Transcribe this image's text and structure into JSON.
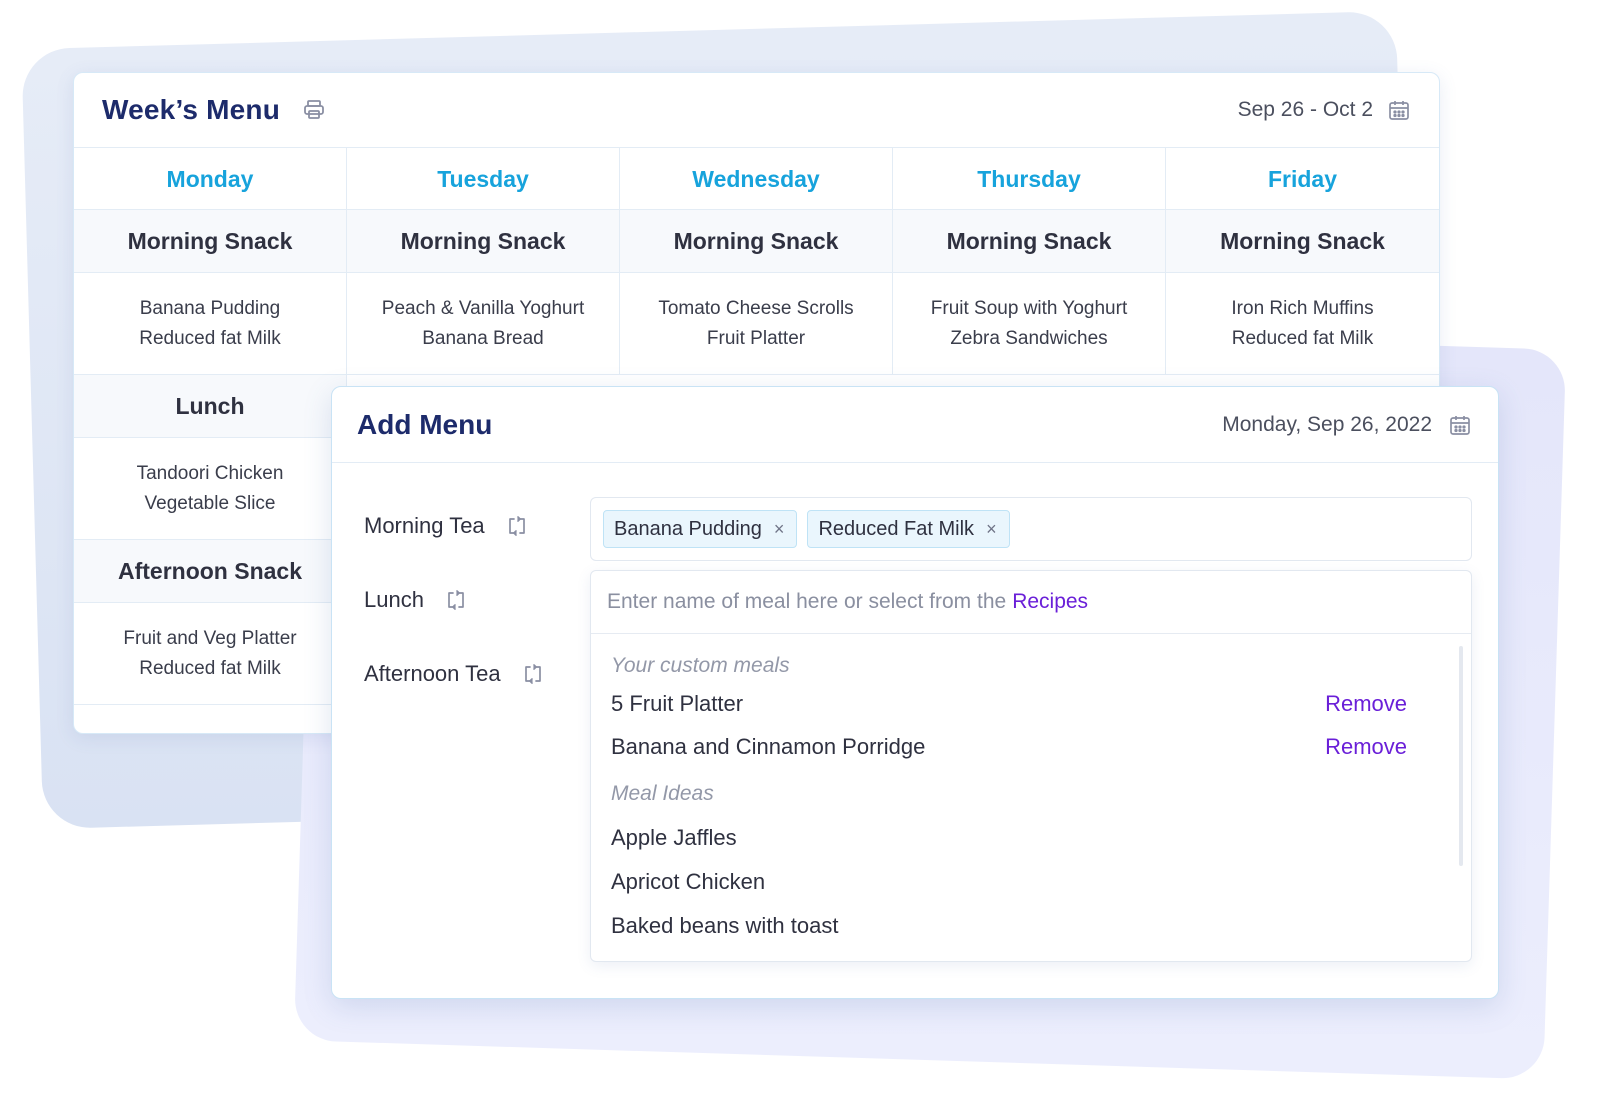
{
  "week_menu": {
    "title": "Week’s Menu",
    "date_range": "Sep 26 - Oct 2",
    "days": [
      "Monday",
      "Tuesday",
      "Wednesday",
      "Thursday",
      "Friday"
    ],
    "morning_snack": {
      "label": "Morning Snack",
      "items": [
        [
          "Banana Pudding",
          "Reduced fat Milk"
        ],
        [
          "Peach & Vanilla Yoghurt",
          "Banana Bread"
        ],
        [
          "Tomato Cheese Scrolls",
          "Fruit Platter"
        ],
        [
          "Fruit Soup with Yoghurt",
          "Zebra Sandwiches"
        ],
        [
          "Iron Rich Muffins",
          "Reduced fat Milk"
        ]
      ]
    },
    "lunch": {
      "label": "Lunch",
      "items": [
        "Tandoori Chicken",
        "Vegetable Slice"
      ]
    },
    "afternoon_snack": {
      "label": "Afternoon Snack",
      "items": [
        "Fruit and Veg Platter",
        "Reduced fat Milk"
      ]
    }
  },
  "add_menu": {
    "title": "Add Menu",
    "date": "Monday, Sep 26, 2022",
    "rows": {
      "morning_tea": "Morning Tea",
      "lunch": "Lunch",
      "afternoon_tea": "Afternoon Tea"
    },
    "tags": [
      "Banana Pudding",
      "Reduced Fat Milk"
    ],
    "tag_remove_glyph": "×",
    "input_placeholder": "Enter name of meal here or select from the",
    "recipes_link": "Recipes",
    "custom_heading": "Your custom meals",
    "custom_meals": [
      "5 Fruit Platter",
      "Banana and Cinnamon Porridge"
    ],
    "remove_label": "Remove",
    "ideas_heading": "Meal Ideas",
    "meal_ideas": [
      "Apple Jaffles",
      "Apricot Chicken",
      "Baked beans with toast"
    ]
  },
  "icons": {
    "print": "printer-icon",
    "calendar": "calendar-icon",
    "repeat": "repeat-icon",
    "close": "close-icon"
  },
  "colors": {
    "title": "#1d2b6b",
    "day_header": "#17a3dc",
    "link": "#6a1fd8",
    "tag_bg": "#eaf6fd"
  }
}
